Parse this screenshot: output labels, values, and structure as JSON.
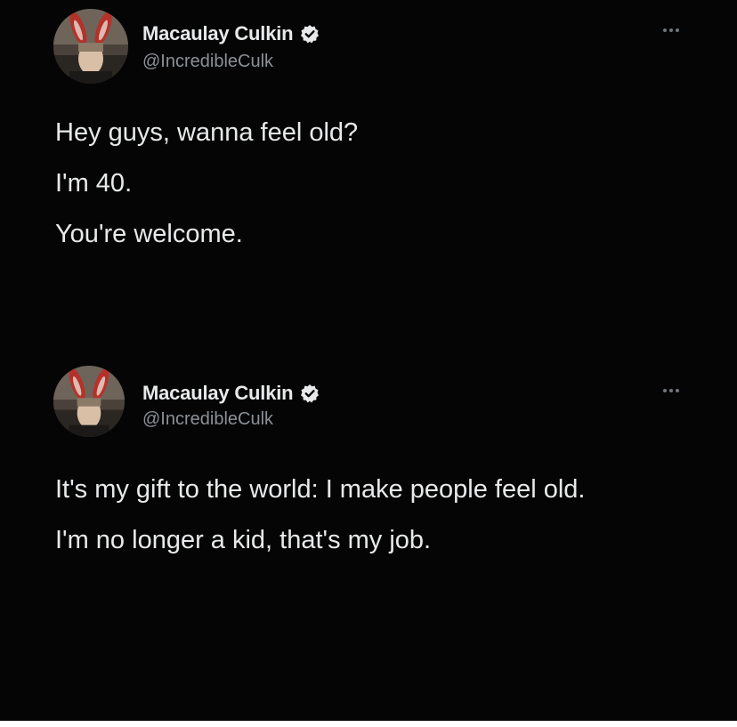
{
  "tweets": [
    {
      "author": {
        "name": "Macaulay Culkin",
        "handle": "@IncredibleCulk",
        "verified": true,
        "avatar": "avatar-photo-bunny-ears"
      },
      "paragraphs": [
        "Hey guys, wanna feel old?",
        "I'm 40.",
        "You're welcome."
      ],
      "menu_icon": "more-options-icon"
    },
    {
      "author": {
        "name": "Macaulay Culkin",
        "handle": "@IncredibleCulk",
        "verified": true,
        "avatar": "avatar-photo-bunny-ears"
      },
      "paragraphs": [
        "It's my gift to the world: I make people feel old.",
        "I'm no longer a kid, that's my job."
      ],
      "menu_icon": "more-options-icon"
    }
  ],
  "colors": {
    "background": "#050505",
    "text": "#e7e9ea",
    "secondary_text": "#8b9096",
    "verified_badge": "#e7e9ea"
  }
}
